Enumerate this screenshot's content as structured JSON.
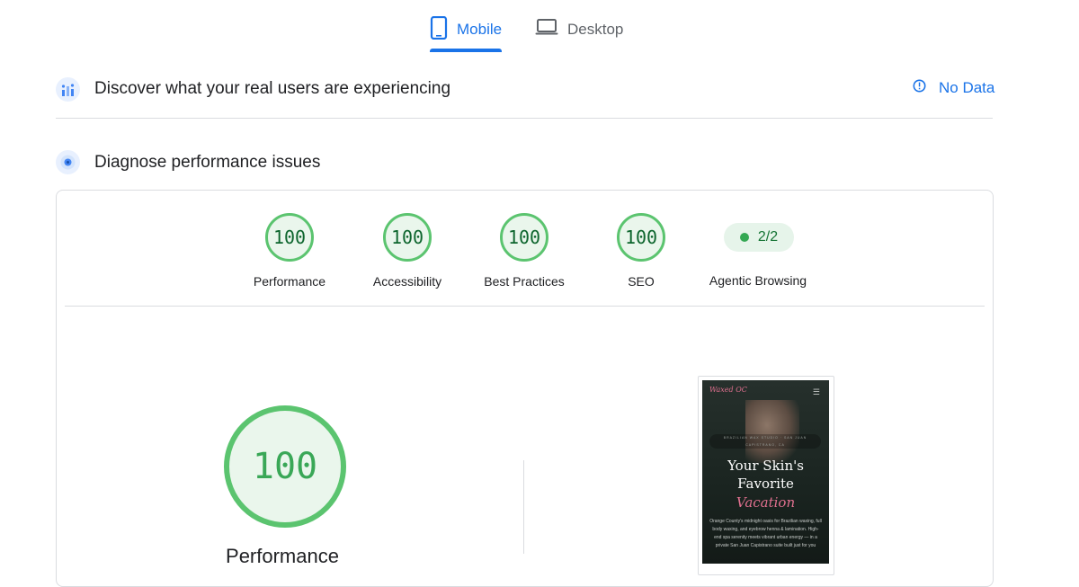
{
  "tabs": [
    {
      "label": "Mobile",
      "active": true,
      "icon": "mobile-icon"
    },
    {
      "label": "Desktop",
      "active": false,
      "icon": "laptop-icon"
    }
  ],
  "field_data": {
    "title": "Discover what your real users are experiencing",
    "status": "No Data",
    "icon": "users-chart-icon",
    "status_icon": "info-icon"
  },
  "diagnose": {
    "title": "Diagnose performance issues",
    "icon": "diagnose-icon"
  },
  "scores": [
    {
      "label": "Performance",
      "value": "100"
    },
    {
      "label": "Accessibility",
      "value": "100"
    },
    {
      "label": "Best Practices",
      "value": "100"
    },
    {
      "label": "SEO",
      "value": "100"
    }
  ],
  "agentic": {
    "value": "2/2",
    "label": "Agentic Browsing"
  },
  "main_gauge": {
    "value": "100",
    "label": "Performance"
  },
  "screenshot": {
    "logo": "Waxed OC",
    "tagline": "BRAZILIAN WAX STUDIO · SAN JUAN CAPISTRANO, CA",
    "heading_line1": "Your Skin's",
    "heading_line2": "Favorite",
    "heading_line3": "Vacation",
    "body": "Orange County's midnight oasis for Brazilian waxing, full body waxing, and eyebrow henna & lamination. High-end spa serenity meets vibrant urban energy — in a private San Juan Capistrano suite built just for you"
  },
  "colors": {
    "accent": "#1a73e8",
    "pass": "#5bc46f",
    "pass_text": "#0d652d",
    "brand_pink": "#e0708f"
  }
}
